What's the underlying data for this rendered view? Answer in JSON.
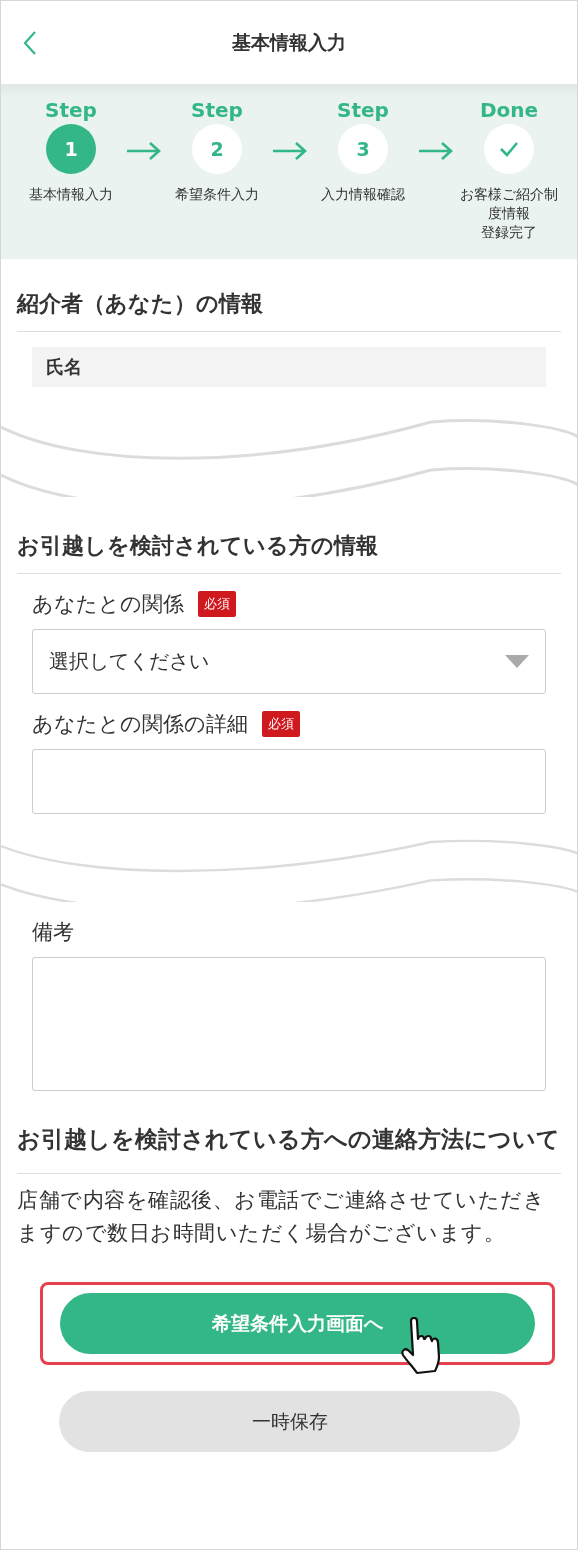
{
  "header": {
    "title": "基本情報入力"
  },
  "steps": [
    {
      "label": "Step",
      "kind": "number",
      "mark": "1",
      "caption": "基本情報入力",
      "selected": true
    },
    {
      "label": "Step",
      "kind": "number",
      "mark": "2",
      "caption": "希望条件入力",
      "selected": false
    },
    {
      "label": "Step",
      "kind": "number",
      "mark": "3",
      "caption": "入力情報確認",
      "selected": false
    },
    {
      "label": "Done",
      "kind": "done",
      "caption": "お客様ご紹介制度情報",
      "caption_2": "登録完了",
      "selected": false
    }
  ],
  "referrer": {
    "heading": "紹介者（あなた）の情報",
    "fields": [
      {
        "label": "氏名"
      }
    ]
  },
  "mover": {
    "heading": "お引越しを検討されている方の情報",
    "fields": [
      {
        "label": "あなたとの関係",
        "badge": "必須",
        "kind": "select",
        "value": "選択してください"
      },
      {
        "label": "あなたとの関係の詳細",
        "badge": "必須",
        "kind": "text"
      }
    ]
  },
  "notes": {
    "label": "備考"
  },
  "contact": {
    "heading": "お引越しを検討されている方への連絡方法について",
    "text": "店舗で内容を確認後、お電話でご連絡させていただきますので数日お時間いただく場合がございます。"
  },
  "buttons": {
    "primary": "希望条件入力画面へ",
    "secondary": "一時保存"
  }
}
